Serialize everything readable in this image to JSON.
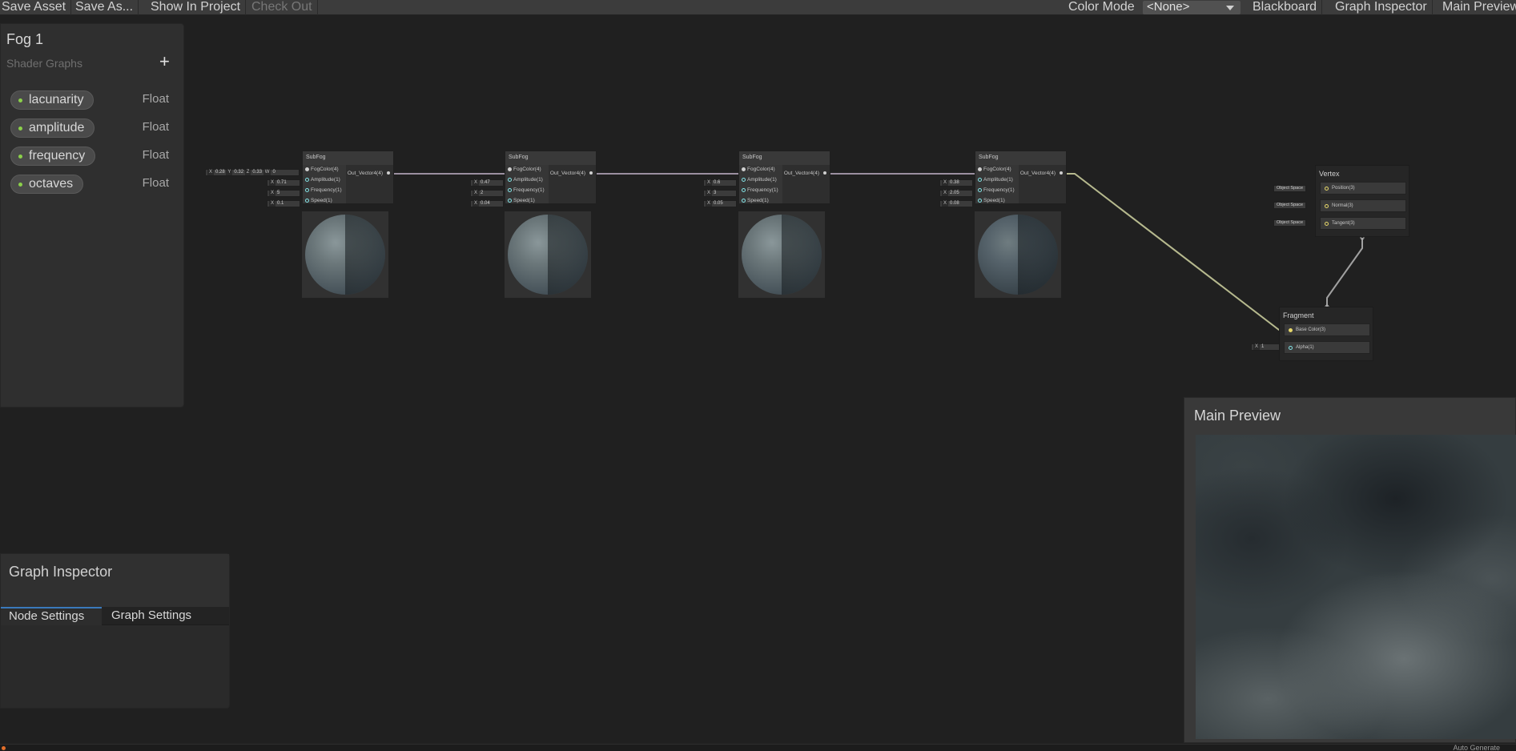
{
  "toolbar": {
    "save_asset": "Save Asset",
    "save_as": "Save As...",
    "show_in_project": "Show In Project",
    "check_out": "Check Out",
    "color_mode_label": "Color Mode",
    "color_mode_value": "<None>",
    "blackboard": "Blackboard",
    "graph_inspector": "Graph Inspector",
    "main_preview": "Main Preview"
  },
  "blackboard": {
    "title": "Fog 1",
    "subtitle": "Shader Graphs",
    "add_icon": "plus-icon",
    "properties": [
      {
        "name": "lacunarity",
        "type": "Float"
      },
      {
        "name": "amplitude",
        "type": "Float"
      },
      {
        "name": "frequency",
        "type": "Float"
      },
      {
        "name": "octaves",
        "type": "Float"
      }
    ]
  },
  "inspector": {
    "title": "Graph Inspector",
    "tabs": [
      "Node Settings",
      "Graph Settings"
    ]
  },
  "nodes": [
    {
      "title": "SubFog",
      "inputs": [
        "FogColor(4)",
        "Amplitude(1)",
        "Frequency(1)",
        "Speed(1)"
      ],
      "output": "Out_Vector4(4)",
      "color_input": {
        "x": "0.28",
        "y": "0.32",
        "z": "0.33",
        "w": "0"
      },
      "values": [
        "0.71",
        "5",
        "0.1"
      ]
    },
    {
      "title": "SubFog",
      "inputs": [
        "FogColor(4)",
        "Amplitude(1)",
        "Frequency(1)",
        "Speed(1)"
      ],
      "output": "Out_Vector4(4)",
      "values": [
        "0.47",
        "2",
        "0.04"
      ]
    },
    {
      "title": "SubFog",
      "inputs": [
        "FogColor(4)",
        "Amplitude(1)",
        "Frequency(1)",
        "Speed(1)"
      ],
      "output": "Out_Vector4(4)",
      "values": [
        "0.6",
        "3",
        "0.05"
      ]
    },
    {
      "title": "SubFog",
      "inputs": [
        "FogColor(4)",
        "Amplitude(1)",
        "Frequency(1)",
        "Speed(1)"
      ],
      "output": "Out_Vector4(4)",
      "values": [
        "0.38",
        "2.05",
        "0.08"
      ]
    }
  ],
  "vertex": {
    "title": "Vertex",
    "space": "Object Space",
    "blocks": [
      "Position(3)",
      "Normal(3)",
      "Tangent(3)"
    ]
  },
  "fragment": {
    "title": "Fragment",
    "blocks": [
      "Base Color(3)",
      "Alpha(1)"
    ],
    "alpha_value": "1"
  },
  "main_preview": {
    "title": "Main Preview"
  },
  "status": {
    "text": "Auto Generate"
  }
}
